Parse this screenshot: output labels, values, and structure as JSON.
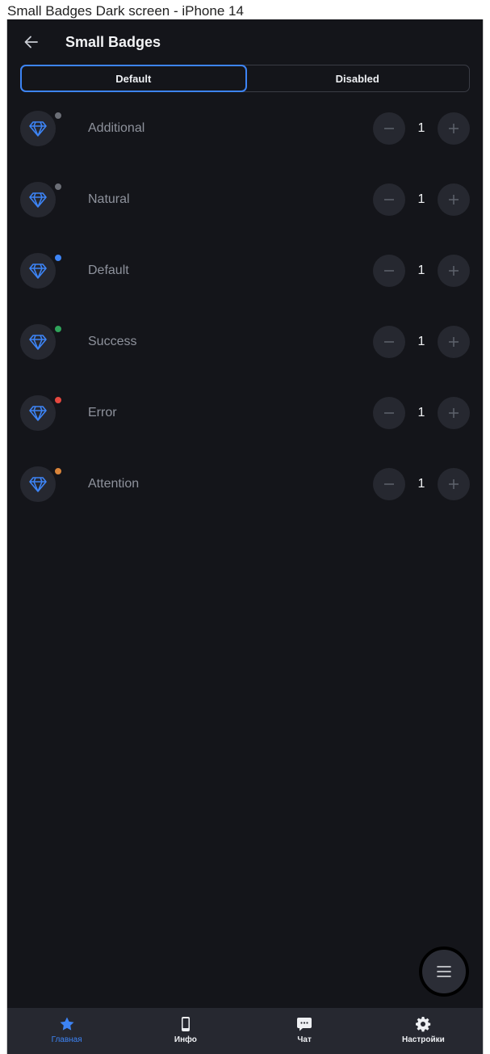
{
  "caption": "Small Badges Dark screen - iPhone 14",
  "header": {
    "title": "Small Badges"
  },
  "segmented": {
    "tabs": [
      {
        "label": "Default",
        "active": true
      },
      {
        "label": "Disabled",
        "active": false
      }
    ]
  },
  "rows": [
    {
      "label": "Additional",
      "badge_color": "#6b6e76",
      "value": "1"
    },
    {
      "label": "Natural",
      "badge_color": "#6b6e76",
      "value": "1"
    },
    {
      "label": "Default",
      "badge_color": "#3d84f5",
      "value": "1"
    },
    {
      "label": "Success",
      "badge_color": "#2fa35a",
      "value": "1"
    },
    {
      "label": "Error",
      "badge_color": "#e5483f",
      "value": "1"
    },
    {
      "label": "Attention",
      "badge_color": "#d9843a",
      "value": "1"
    }
  ],
  "tabbar": {
    "items": [
      {
        "label": "Главная",
        "icon": "star-icon",
        "active": true
      },
      {
        "label": "Инфо",
        "icon": "phone-icon",
        "active": false
      },
      {
        "label": "Чат",
        "icon": "chat-icon",
        "active": false
      },
      {
        "label": "Настройки",
        "icon": "gear-icon",
        "active": false
      }
    ]
  },
  "colors": {
    "background": "#14151a",
    "surface": "#262830",
    "accent": "#3d84f5",
    "text_primary": "#f2f3f5",
    "text_secondary": "#8e929c"
  }
}
